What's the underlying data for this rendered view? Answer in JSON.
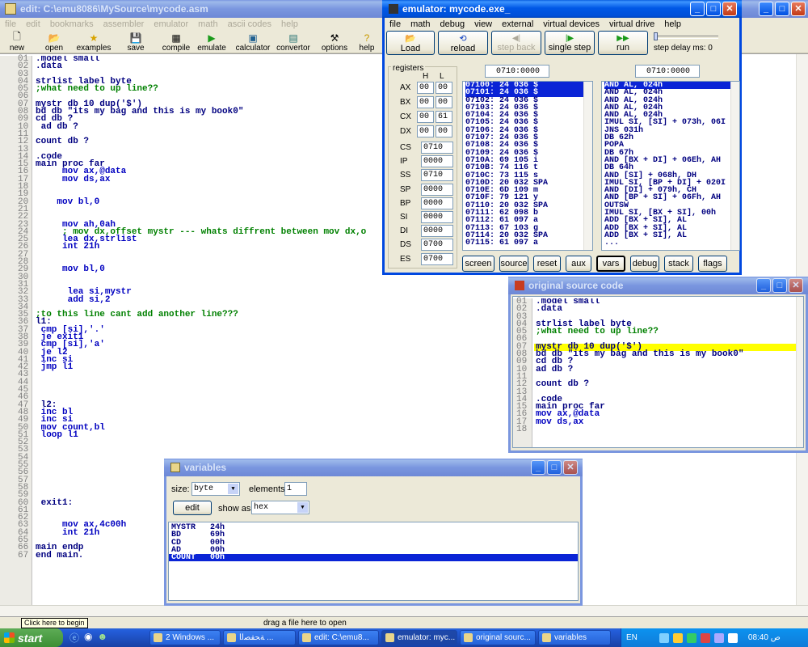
{
  "editor": {
    "title": "edit: C:\\emu8086\\MySource\\mycode.asm",
    "menu": [
      "file",
      "edit",
      "bookmarks",
      "assembler",
      "emulator",
      "math",
      "ascii codes",
      "help"
    ],
    "toolbar": [
      "new",
      "open",
      "examples",
      "save",
      "compile",
      "emulate",
      "calculator",
      "convertor",
      "options",
      "help"
    ],
    "gutter": [
      "01",
      "02",
      "03",
      "04",
      "05",
      "06",
      "07",
      "08",
      "09",
      "10",
      "11",
      "12",
      "13",
      "14",
      "15",
      "16",
      "17",
      "18",
      "19",
      "20",
      "21",
      "22",
      "23",
      "24",
      "25",
      "26",
      "27",
      "28",
      "29",
      "30",
      "31",
      "32",
      "33",
      "34",
      "35",
      "36",
      "37",
      "38",
      "39",
      "40",
      "41",
      "42",
      "43",
      "44",
      "45",
      "46",
      "47",
      "48",
      "49",
      "50",
      "51",
      "52",
      "53",
      "54",
      "55",
      "56",
      "57",
      "58",
      "59",
      "60",
      "61",
      "62",
      "63",
      "64",
      "65",
      "66",
      "67"
    ],
    "lines": [
      ".model small",
      ".data",
      "",
      "strlist label byte",
      ";what need to up line??",
      "",
      "mystr db 10 dup('$')",
      "bd db \"its my bag and this is my book0\"",
      "cd db ?",
      " ad db ?",
      "",
      "count db ?",
      "",
      ".code",
      "main proc far",
      "     mov ax,@data",
      "     mov ds,ax",
      "",
      "",
      "    mov bl,0",
      "",
      "",
      "     mov ah,0ah",
      "     ; mov dx,offset mystr --- whats diffrent between mov dx,o",
      "     lea dx,strlist",
      "     int 21h",
      "",
      "",
      "     mov bl,0",
      "",
      "",
      "      lea si,mystr",
      "      add si,2",
      "",
      ";to this line cant add another line???",
      "l1:",
      " cmp [si],'.'",
      " je exit1",
      " cmp [si],'a'",
      " je l2",
      " inc si",
      " jmp l1",
      "",
      "",
      "",
      "",
      " l2:",
      " inc bl",
      " inc si",
      " mov count,bl",
      " loop l1",
      "",
      "",
      "",
      "",
      "",
      "",
      "",
      "",
      " exit1:",
      "",
      "",
      "     mov ax,4c00h",
      "     int 21h",
      "",
      "main endp",
      "end main."
    ],
    "tooltip": "Click here to begin",
    "status": "drag a file here to open"
  },
  "emulator": {
    "title": "emulator: mycode.exe_",
    "menu": [
      "file",
      "math",
      "debug",
      "view",
      "external",
      "virtual devices",
      "virtual drive",
      "help"
    ],
    "buttons": {
      "load": "Load",
      "reload": "reload",
      "step_back": "step back",
      "single_step": "single step",
      "run": "run",
      "step_delay": "step delay ms: 0"
    },
    "registers_label": "registers",
    "h_label": "H",
    "l_label": "L",
    "regs_hl": [
      {
        "name": "AX",
        "h": "00",
        "l": "00"
      },
      {
        "name": "BX",
        "h": "00",
        "l": "00"
      },
      {
        "name": "CX",
        "h": "00",
        "l": "61"
      },
      {
        "name": "DX",
        "h": "00",
        "l": "00"
      }
    ],
    "regs": [
      {
        "name": "CS",
        "v": "0710"
      },
      {
        "name": "IP",
        "v": "0000"
      },
      {
        "name": "SS",
        "v": "0710"
      },
      {
        "name": "SP",
        "v": "0000"
      },
      {
        "name": "BP",
        "v": "0000"
      },
      {
        "name": "SI",
        "v": "0000"
      },
      {
        "name": "DI",
        "v": "0000"
      },
      {
        "name": "DS",
        "v": "0700"
      },
      {
        "name": "ES",
        "v": "0700"
      }
    ],
    "addr1": "0710:0000",
    "addr2": "0710:0000",
    "memory": [
      "07100: 24 036 $",
      "07101: 24 036 $",
      "07102: 24 036 $",
      "07103: 24 036 $",
      "07104: 24 036 $",
      "07105: 24 036 $",
      "07106: 24 036 $",
      "07107: 24 036 $",
      "07108: 24 036 $",
      "07109: 24 036 $",
      "0710A: 69 105 i",
      "0710B: 74 116 t",
      "0710C: 73 115 s",
      "0710D: 20 032 SPA",
      "0710E: 6D 109 m",
      "0710F: 79 121 y",
      "07110: 20 032 SPA",
      "07111: 62 098 b",
      "07112: 61 097 a",
      "07113: 67 103 g",
      "07114: 20 032 SPA",
      "07115: 61 097 a"
    ],
    "disasm": [
      "AND AL, 024h",
      "AND AL, 024h",
      "AND AL, 024h",
      "AND AL, 024h",
      "AND AL, 024h",
      "IMUL SI, [SI] + 073h, 06I",
      "JNS 031h",
      "DB 62h",
      "POPA",
      "DB 67h",
      "AND [BX + DI] + 06Eh, AH",
      "DB 64h",
      "AND [SI] + 068h, DH",
      "IMUL SI, [BP + DI] + 020I",
      "AND [DI] + 079h, CH",
      "AND [BP + SI] + 06Fh, AH",
      "OUTSW",
      "IMUL SI, [BX + SI], 00h",
      "ADD [BX + SI], AL",
      "ADD [BX + SI], AL",
      "ADD [BX + SI], AL",
      "..."
    ],
    "bottom": [
      "screen",
      "source",
      "reset",
      "aux",
      "vars",
      "debug",
      "stack",
      "flags"
    ]
  },
  "source": {
    "title": "original source code",
    "gutter": [
      "01",
      "02",
      "03",
      "04",
      "05",
      "06",
      "07",
      "08",
      "09",
      "10",
      "11",
      "12",
      "13",
      "14",
      "15",
      "16",
      "17",
      "18"
    ],
    "lines": [
      ".model small",
      ".data",
      "",
      "strlist label byte",
      ";what need to up line??",
      "",
      "mystr db 10 dup('$')",
      "bd db \"its my bag and this is my book0\"",
      "cd db ?",
      "ad db ?",
      "",
      "count db ?",
      "",
      ".code",
      "main proc far",
      "mov ax,@data",
      "mov ds,ax",
      ""
    ]
  },
  "variables": {
    "title": "variables",
    "size_label": "size:",
    "size_value": "byte",
    "elements_label": "elements:",
    "elements_value": "1",
    "edit": "edit",
    "show_as_label": "show as:",
    "show_as_value": "hex",
    "rows": [
      {
        "name": "MYSTR",
        "val": "24h"
      },
      {
        "name": "BD",
        "val": "69h"
      },
      {
        "name": "CD",
        "val": "00h"
      },
      {
        "name": "AD",
        "val": "00h"
      },
      {
        "name": "COUNT",
        "val": "00h"
      }
    ]
  },
  "taskbar": {
    "start": "start",
    "tasks": [
      "2 Windows ...",
      "ﺔﺤﻔﺼﻟا ...",
      "edit: C:\\emu8...",
      "emulator: myc...",
      "original sourc...",
      "variables"
    ],
    "lang": "EN",
    "clock": "08:40 ﺹ"
  }
}
